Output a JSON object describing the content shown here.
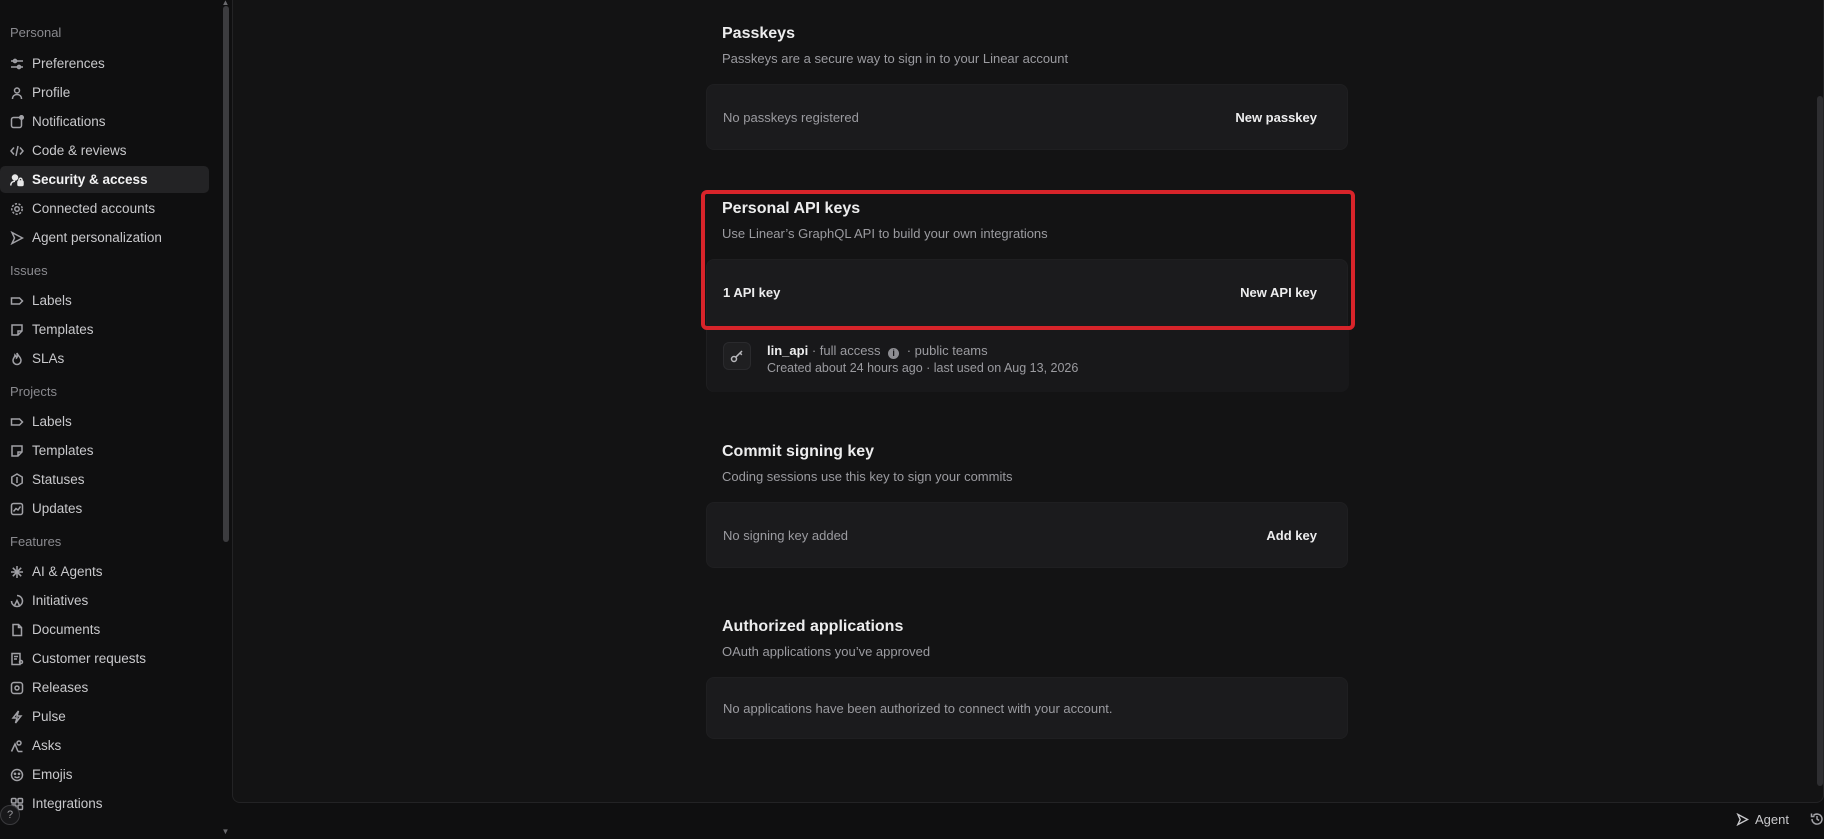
{
  "sidebar": {
    "sections": [
      {
        "title": "Personal",
        "items": [
          {
            "label": "Preferences",
            "icon": "sliders-icon"
          },
          {
            "label": "Profile",
            "icon": "person-icon"
          },
          {
            "label": "Notifications",
            "icon": "notification-icon"
          },
          {
            "label": "Code & reviews",
            "icon": "code-icon"
          },
          {
            "label": "Security & access",
            "icon": "user-lock-icon",
            "active": true
          },
          {
            "label": "Connected accounts",
            "icon": "gear-icon"
          },
          {
            "label": "Agent personalization",
            "icon": "agent-icon"
          }
        ]
      },
      {
        "title": "Issues",
        "items": [
          {
            "label": "Labels",
            "icon": "label-icon"
          },
          {
            "label": "Templates",
            "icon": "template-icon"
          },
          {
            "label": "SLAs",
            "icon": "flame-icon"
          }
        ]
      },
      {
        "title": "Projects",
        "items": [
          {
            "label": "Labels",
            "icon": "label-icon"
          },
          {
            "label": "Templates",
            "icon": "template-icon"
          },
          {
            "label": "Statuses",
            "icon": "hexagon-icon"
          },
          {
            "label": "Updates",
            "icon": "chart-icon"
          }
        ]
      },
      {
        "title": "Features",
        "items": [
          {
            "label": "AI & Agents",
            "icon": "sparkle-icon"
          },
          {
            "label": "Initiatives",
            "icon": "initiative-icon"
          },
          {
            "label": "Documents",
            "icon": "document-icon"
          },
          {
            "label": "Customer requests",
            "icon": "customer-icon"
          },
          {
            "label": "Releases",
            "icon": "release-icon"
          },
          {
            "label": "Pulse",
            "icon": "pulse-icon"
          },
          {
            "label": "Asks",
            "icon": "asks-icon"
          },
          {
            "label": "Emojis",
            "icon": "emoji-icon"
          },
          {
            "label": "Integrations",
            "icon": "integrations-icon"
          }
        ]
      }
    ],
    "help_label": "?"
  },
  "passkeys": {
    "title": "Passkeys",
    "description": "Passkeys are a secure way to sign in to your Linear account",
    "empty_text": "No passkeys registered",
    "button": "New passkey"
  },
  "api_keys": {
    "title": "Personal API keys",
    "description": "Use Linear’s GraphQL API to build your own integrations",
    "count_text": "1 API key",
    "button": "New API key",
    "keys": [
      {
        "name": "lin_api",
        "access": "· full access",
        "scope": "· public teams",
        "meta": "Created about 24 hours ago · last used on Aug 13, 2026"
      }
    ]
  },
  "commit_signing": {
    "title": "Commit signing key",
    "description": "Coding sessions use this key to sign your commits",
    "empty_text": "No signing key added",
    "button": "Add key"
  },
  "authorized_apps": {
    "title": "Authorized applications",
    "description": "OAuth applications you’ve approved",
    "empty_text": "No applications have been authorized to connect with your account."
  },
  "bottom_bar": {
    "agent_label": "Agent"
  },
  "colors": {
    "highlight": "#d8242a",
    "background": "#0f0f10",
    "panel": "#131314",
    "card": "#1b1b1d"
  }
}
